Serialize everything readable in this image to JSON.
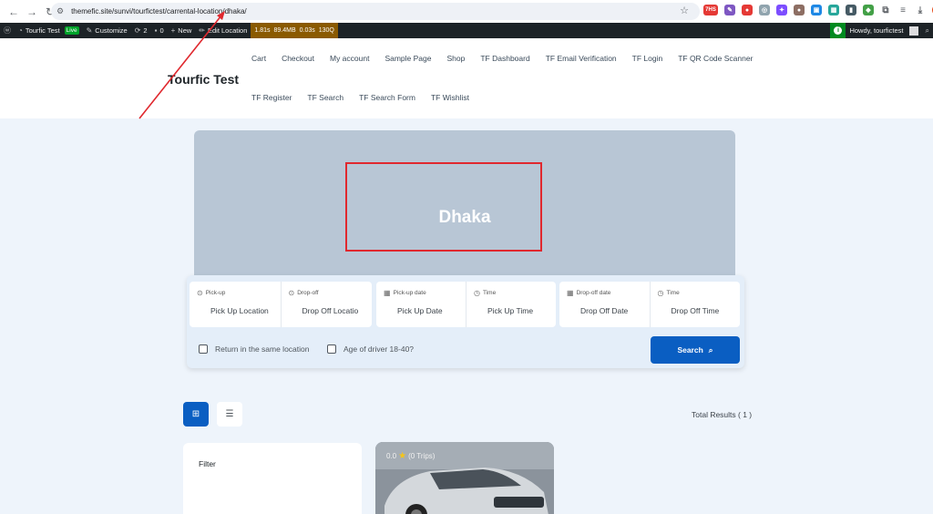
{
  "browser": {
    "url": "themefic.site/sunvi/tourfictest/carrental-location/dhaka/",
    "ext_badge": "7HS"
  },
  "admin_bar": {
    "site_name": "Tourfic Test",
    "live_label": "Live",
    "customize": "Customize",
    "updates": "2",
    "comments": "0",
    "new": "New",
    "edit_location": "Edit Location",
    "perf": [
      "1.81s",
      "89.4MB",
      "0.03s",
      "130Q"
    ],
    "greeting": "Howdy, tourfictest"
  },
  "header": {
    "site_title": "Tourfic Test",
    "menu_row1": [
      "Cart",
      "Checkout",
      "My account",
      "Sample Page",
      "Shop",
      "TF Dashboard",
      "TF Email Verification",
      "TF Login",
      "TF QR Code Scanner"
    ],
    "menu_row2": [
      "TF Register",
      "TF Search",
      "TF Search Form",
      "TF Wishlist"
    ]
  },
  "banner": {
    "title": "Dhaka"
  },
  "search": {
    "pickup_label": "Pick-up",
    "pickup_placeholder": "Pick Up Location",
    "dropoff_label": "Drop-off",
    "dropoff_placeholder": "Drop Off Locatio",
    "pickup_date_label": "Pick-up date",
    "pickup_date_value": "Pick Up Date",
    "time_label_1": "Time",
    "pickup_time_value": "Pick Up Time",
    "dropoff_date_label": "Drop-off date",
    "dropoff_date_value": "Drop Off Date",
    "time_label_2": "Time",
    "dropoff_time_value": "Drop Off Time",
    "return_same": "Return in the same location",
    "driver_age": "Age of driver 18-40?",
    "button": "Search"
  },
  "results": {
    "total": "Total Results ( 1 )"
  },
  "filter": {
    "title": "Filter"
  },
  "car": {
    "rating": "0.0",
    "trips": "(0 Trips)"
  }
}
